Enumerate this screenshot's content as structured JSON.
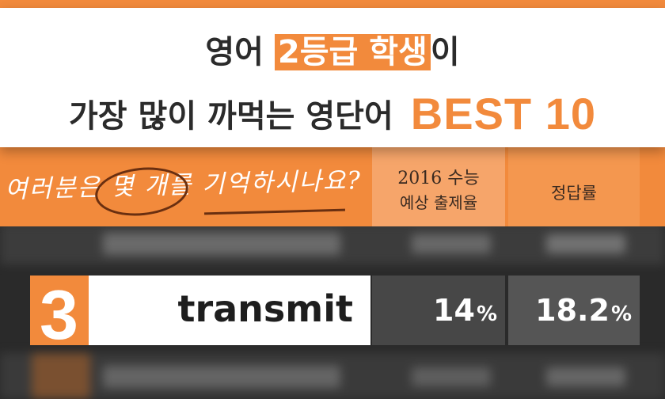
{
  "title": {
    "line1_pre": "영어 ",
    "line1_highlight": "2등급 학생",
    "line1_post": "이",
    "line2_main": "가장 많이 까먹는 영단어",
    "line2_best": "BEST 10"
  },
  "header": {
    "tagline": "여러분은 몇 개를 기억하시나요?",
    "col1_line1": "2016 수능",
    "col1_line2": "예상 출제율",
    "col2_label": "정답률"
  },
  "row": {
    "rank": "3",
    "word": "transmit",
    "rate_value": "14",
    "rate_unit": "%",
    "accuracy_value": "18.2",
    "accuracy_unit": "%"
  },
  "colors": {
    "accent_orange": "#f28a3c",
    "header_col1": "#f6a56a",
    "header_col2": "#f4974f",
    "dark_bg": "#2a2a2a",
    "value_col1": "#474747",
    "value_col2": "#555555"
  }
}
